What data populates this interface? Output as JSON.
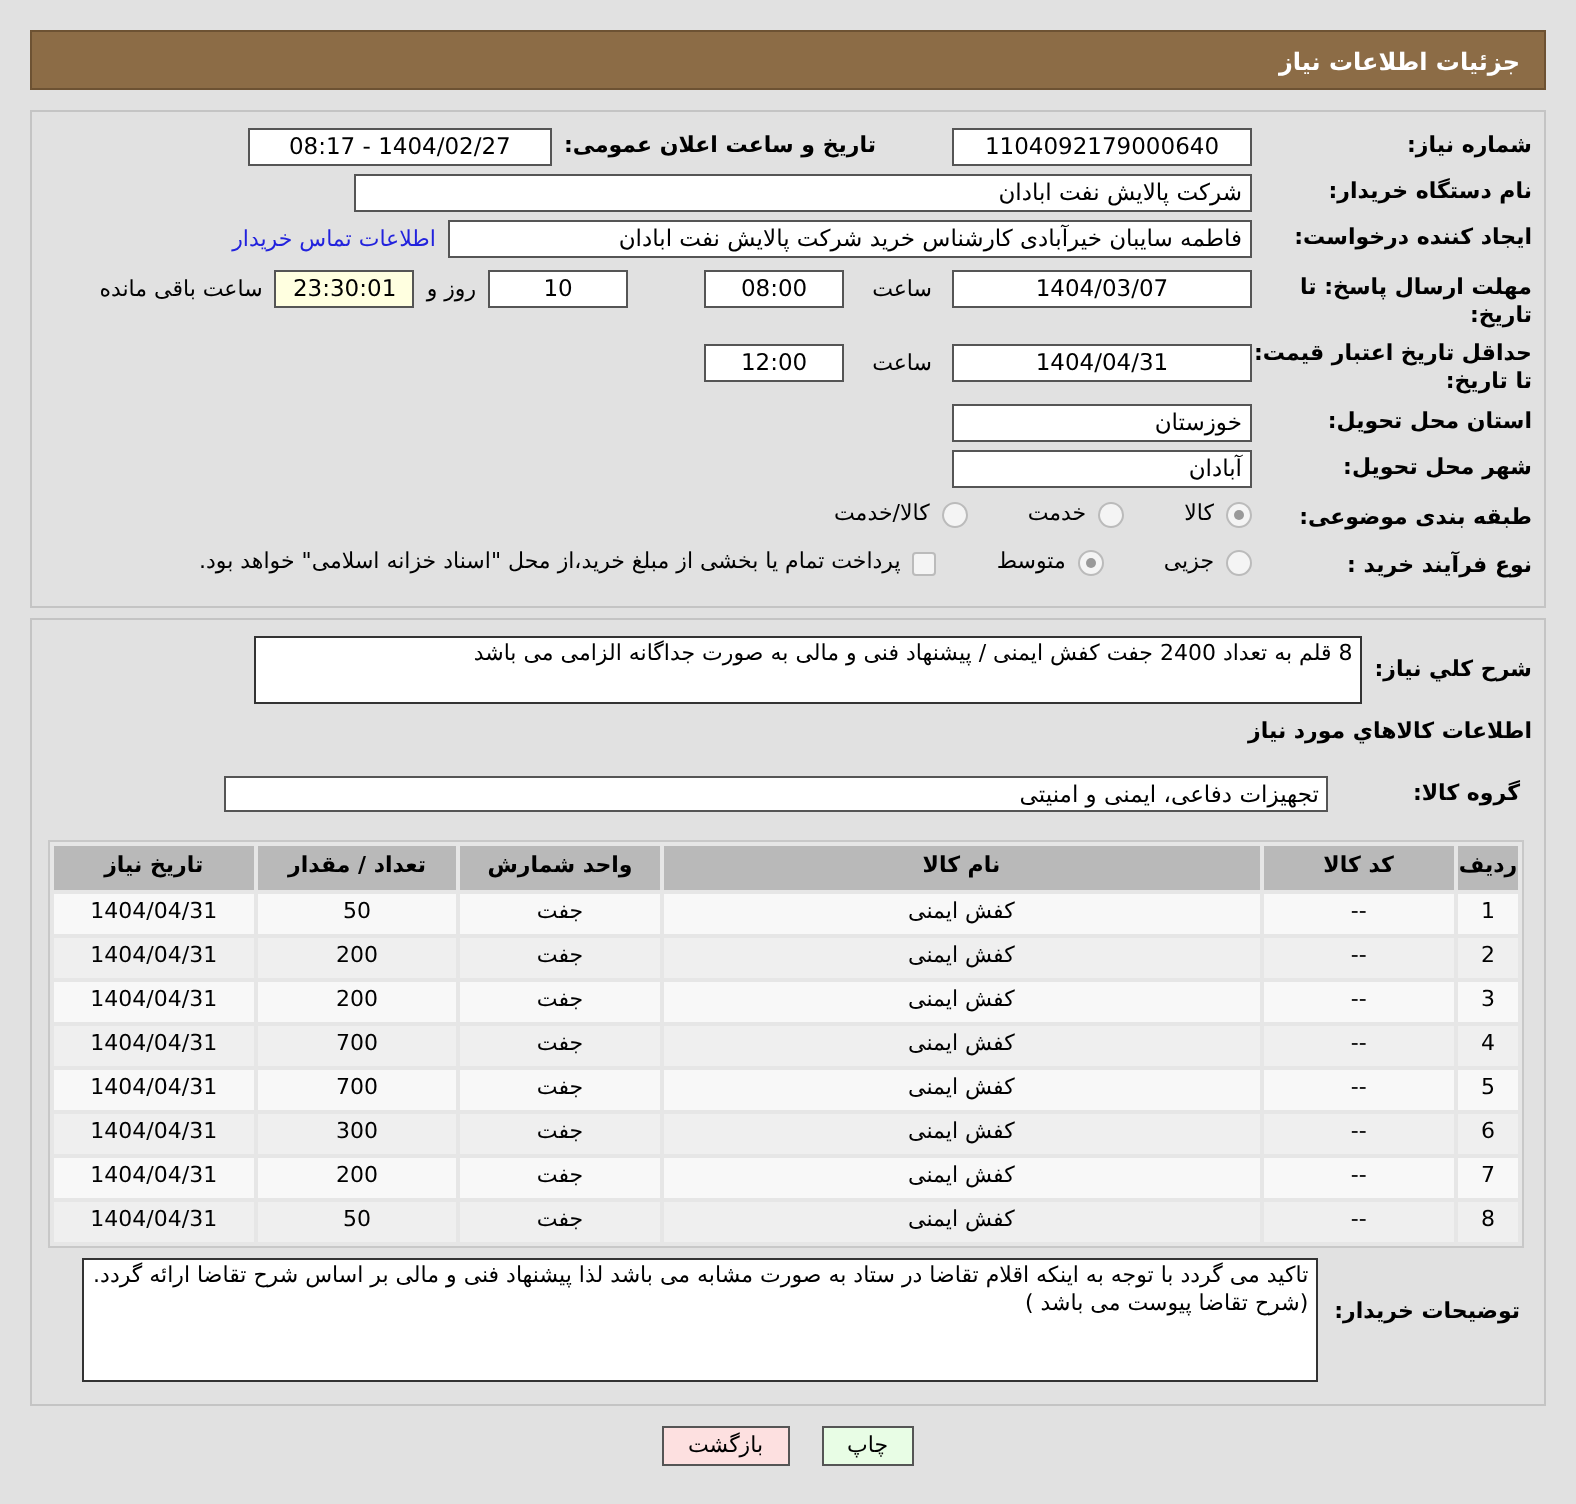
{
  "header": {
    "title": "جزئیات اطلاعات نیاز"
  },
  "need_number": {
    "label": "شماره نیاز:",
    "value": "1104092179000640"
  },
  "announce": {
    "label": "تاریخ و ساعت اعلان عمومی:",
    "value": "1404/02/27 - 08:17"
  },
  "buyer": {
    "label": "نام دستگاه خریدار:",
    "value": "شرکت پالایش نفت ابادان"
  },
  "requester": {
    "label": "ایجاد کننده درخواست:",
    "value": "فاطمه سایبان خیرآبادی کارشناس خرید شرکت پالایش نفت ابادان",
    "link": "اطلاعات تماس خریدار"
  },
  "deadline": {
    "label": "مهلت ارسال پاسخ: تا تاریخ:",
    "date": "1404/03/07",
    "time_label": "ساعت",
    "time": "08:00",
    "days": "10",
    "days_label": "روز و",
    "remaining": "23:30:01",
    "remaining_label": "ساعت باقی مانده"
  },
  "validity": {
    "label": "حداقل تاریخ اعتبار قیمت: تا تاریخ:",
    "date": "1404/04/31",
    "time_label": "ساعت",
    "time": "12:00"
  },
  "province": {
    "label": "استان محل تحویل:",
    "value": "خوزستان"
  },
  "city": {
    "label": "شهر محل تحویل:",
    "value": "آبادان"
  },
  "category": {
    "label": "طبقه بندی موضوعی:",
    "options": [
      {
        "label": "کالا",
        "selected": true
      },
      {
        "label": "خدمت",
        "selected": false
      },
      {
        "label": "کالا/خدمت",
        "selected": false
      }
    ]
  },
  "process": {
    "label": "نوع فرآیند خرید :",
    "options": [
      {
        "label": "جزیی",
        "selected": false
      },
      {
        "label": "متوسط",
        "selected": true
      }
    ],
    "payment": {
      "label": "پرداخت تمام یا بخشی از مبلغ خرید،از محل \"اسناد خزانه اسلامی\" خواهد بود.",
      "checked": false
    }
  },
  "description": {
    "label": "شرح کلي نياز:",
    "value": "8 قلم به تعداد 2400 جفت کفش ایمنی / پیشنهاد فنی و مالی به صورت جداگانه الزامی می باشد"
  },
  "goods_title": "اطلاعات کالاهاي مورد نياز",
  "goods_group": {
    "label": "گروه کالا:",
    "value": "تجهیزات دفاعی، ایمنی و امنیتی"
  },
  "table": {
    "columns": [
      "ردیف",
      "کد کالا",
      "نام کالا",
      "واحد شمارش",
      "تعداد / مقدار",
      "تاریخ نیاز"
    ],
    "rows": [
      [
        "1",
        "--",
        "کفش ایمنی",
        "جفت",
        "50",
        "1404/04/31"
      ],
      [
        "2",
        "--",
        "کفش ایمنی",
        "جفت",
        "200",
        "1404/04/31"
      ],
      [
        "3",
        "--",
        "کفش ایمنی",
        "جفت",
        "200",
        "1404/04/31"
      ],
      [
        "4",
        "--",
        "کفش ایمنی",
        "جفت",
        "700",
        "1404/04/31"
      ],
      [
        "5",
        "--",
        "کفش ایمنی",
        "جفت",
        "700",
        "1404/04/31"
      ],
      [
        "6",
        "--",
        "کفش ایمنی",
        "جفت",
        "300",
        "1404/04/31"
      ],
      [
        "7",
        "--",
        "کفش ایمنی",
        "جفت",
        "200",
        "1404/04/31"
      ],
      [
        "8",
        "--",
        "کفش ایمنی",
        "جفت",
        "50",
        "1404/04/31"
      ]
    ]
  },
  "buyer_notes": {
    "label": "توضیحات خریدار:",
    "value": "تاکید می گردد با توجه به اینکه اقلام تقاضا در ستاد به  صورت مشابه می باشد لذا پیشنهاد فنی و مالی بر اساس شرح تقاضا ارائه گردد.(شرح تقاضا پیوست می باشد )"
  },
  "buttons": [
    {
      "label": "چاپ",
      "kind": "print"
    },
    {
      "label": "بازگشت",
      "kind": "back"
    }
  ]
}
